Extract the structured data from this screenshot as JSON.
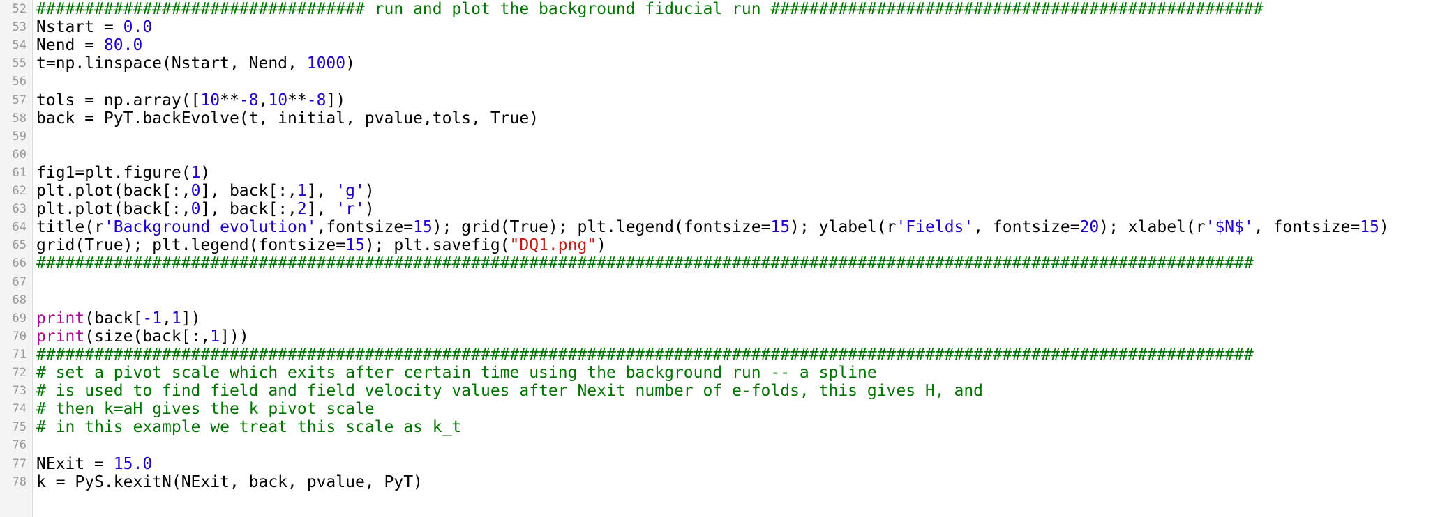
{
  "editor": {
    "colors": {
      "text": "#000000",
      "number": "#1c00cf",
      "string": "#c41a16",
      "comment": "#007400",
      "keyword": "#aa0d91",
      "line_number": "#9a9a9a"
    },
    "lines": [
      {
        "n": "52",
        "segments": [
          {
            "t": "################################## run and plot the background fiducial run ###################################################",
            "c": "cmt"
          }
        ]
      },
      {
        "n": "53",
        "segments": [
          {
            "t": "Nstart = ",
            "c": ""
          },
          {
            "t": "0.0",
            "c": "num"
          }
        ]
      },
      {
        "n": "54",
        "segments": [
          {
            "t": "Nend = ",
            "c": ""
          },
          {
            "t": "80.0",
            "c": "num"
          }
        ]
      },
      {
        "n": "55",
        "segments": [
          {
            "t": "t=np.linspace(Nstart, Nend, ",
            "c": ""
          },
          {
            "t": "1000",
            "c": "num"
          },
          {
            "t": ")",
            "c": ""
          }
        ]
      },
      {
        "n": "56",
        "segments": []
      },
      {
        "n": "57",
        "segments": [
          {
            "t": "tols = np.array([",
            "c": ""
          },
          {
            "t": "10",
            "c": "num"
          },
          {
            "t": "**",
            "c": ""
          },
          {
            "t": "-8",
            "c": "num"
          },
          {
            "t": ",",
            "c": ""
          },
          {
            "t": "10",
            "c": "num"
          },
          {
            "t": "**",
            "c": ""
          },
          {
            "t": "-8",
            "c": "num"
          },
          {
            "t": "])",
            "c": ""
          }
        ]
      },
      {
        "n": "58",
        "segments": [
          {
            "t": "back = PyT.backEvolve(t, initial, pvalue,tols, True)",
            "c": ""
          }
        ]
      },
      {
        "n": "59",
        "segments": []
      },
      {
        "n": "60",
        "segments": []
      },
      {
        "n": "61",
        "segments": [
          {
            "t": "fig1=plt.figure(",
            "c": ""
          },
          {
            "t": "1",
            "c": "num"
          },
          {
            "t": ")",
            "c": ""
          }
        ]
      },
      {
        "n": "62",
        "segments": [
          {
            "t": "plt.plot(back[:,",
            "c": ""
          },
          {
            "t": "0",
            "c": "num"
          },
          {
            "t": "], back[:,",
            "c": ""
          },
          {
            "t": "1",
            "c": "num"
          },
          {
            "t": "], ",
            "c": ""
          },
          {
            "t": "'g'",
            "c": "num"
          },
          {
            "t": ")",
            "c": ""
          }
        ]
      },
      {
        "n": "63",
        "segments": [
          {
            "t": "plt.plot(back[:,",
            "c": ""
          },
          {
            "t": "0",
            "c": "num"
          },
          {
            "t": "], back[:,",
            "c": ""
          },
          {
            "t": "2",
            "c": "num"
          },
          {
            "t": "], ",
            "c": ""
          },
          {
            "t": "'r'",
            "c": "num"
          },
          {
            "t": ")",
            "c": ""
          }
        ]
      },
      {
        "n": "64",
        "segments": [
          {
            "t": "title(r",
            "c": ""
          },
          {
            "t": "'Background evolution'",
            "c": "num"
          },
          {
            "t": ",fontsize=",
            "c": ""
          },
          {
            "t": "15",
            "c": "num"
          },
          {
            "t": "); grid(True); plt.legend(fontsize=",
            "c": ""
          },
          {
            "t": "15",
            "c": "num"
          },
          {
            "t": "); ylabel(r",
            "c": ""
          },
          {
            "t": "'Fields'",
            "c": "num"
          },
          {
            "t": ", fontsize=",
            "c": ""
          },
          {
            "t": "20",
            "c": "num"
          },
          {
            "t": "); xlabel(r",
            "c": ""
          },
          {
            "t": "'$N$'",
            "c": "num"
          },
          {
            "t": ", fontsize=",
            "c": ""
          },
          {
            "t": "15",
            "c": "num"
          },
          {
            "t": ")",
            "c": ""
          }
        ]
      },
      {
        "n": "65",
        "segments": [
          {
            "t": "grid(True); plt.legend(fontsize=",
            "c": ""
          },
          {
            "t": "15",
            "c": "num"
          },
          {
            "t": "); plt.savefig(",
            "c": ""
          },
          {
            "t": "\"DQ1.png\"",
            "c": "str"
          },
          {
            "t": ")",
            "c": ""
          }
        ]
      },
      {
        "n": "66",
        "segments": [
          {
            "t": "##############################################################################################################################",
            "c": "cmt"
          }
        ]
      },
      {
        "n": "67",
        "segments": []
      },
      {
        "n": "68",
        "segments": []
      },
      {
        "n": "69",
        "segments": [
          {
            "t": "print",
            "c": "kw"
          },
          {
            "t": "(back[",
            "c": ""
          },
          {
            "t": "-1",
            "c": "num"
          },
          {
            "t": ",",
            "c": ""
          },
          {
            "t": "1",
            "c": "num"
          },
          {
            "t": "])",
            "c": ""
          }
        ]
      },
      {
        "n": "70",
        "segments": [
          {
            "t": "print",
            "c": "kw"
          },
          {
            "t": "(size(back[:,",
            "c": ""
          },
          {
            "t": "1",
            "c": "num"
          },
          {
            "t": "]))",
            "c": ""
          }
        ]
      },
      {
        "n": "71",
        "segments": [
          {
            "t": "##############################################################################################################################",
            "c": "cmt"
          }
        ]
      },
      {
        "n": "72",
        "segments": [
          {
            "t": "# set a pivot scale which exits after certain time using the background run -- a spline",
            "c": "cmt"
          }
        ]
      },
      {
        "n": "73",
        "segments": [
          {
            "t": "# is used to find field and field velocity values after Nexit number of e-folds, this gives H, and",
            "c": "cmt"
          }
        ]
      },
      {
        "n": "74",
        "segments": [
          {
            "t": "# then k=aH gives the k pivot scale",
            "c": "cmt"
          }
        ]
      },
      {
        "n": "75",
        "segments": [
          {
            "t": "# in this example we treat this scale as k_t",
            "c": "cmt"
          }
        ]
      },
      {
        "n": "76",
        "segments": []
      },
      {
        "n": "77",
        "segments": [
          {
            "t": "NExit = ",
            "c": ""
          },
          {
            "t": "15.0",
            "c": "num"
          }
        ]
      },
      {
        "n": "78",
        "segments": [
          {
            "t": "k = PyS.kexitN(NExit, back, pvalue, PyT)",
            "c": ""
          }
        ]
      }
    ]
  }
}
